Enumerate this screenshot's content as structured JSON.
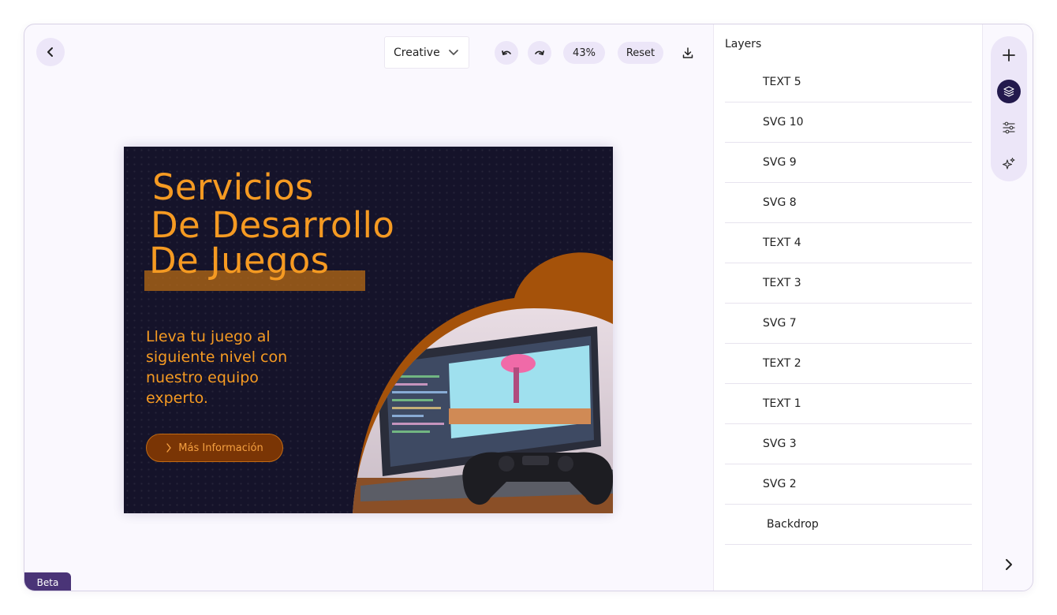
{
  "toolbar": {
    "preset_value": "Creative",
    "zoom": "43%",
    "reset_label": "Reset"
  },
  "design": {
    "headline_lines": [
      "Servicios",
      "De Desarrollo",
      "De Juegos"
    ],
    "subtext": "Lleva tu juego al siguiente nivel con nuestro equipo experto.",
    "cta_label": "Más Información",
    "colors": {
      "background": "#15132a",
      "accent": "#f59a22",
      "shape": "#a5520a"
    }
  },
  "layers": {
    "title": "Layers",
    "items": [
      "TEXT 5",
      "SVG 10",
      "SVG 9",
      "SVG 8",
      "TEXT 4",
      "TEXT 3",
      "SVG 7",
      "TEXT 2",
      "TEXT 1",
      "SVG 3",
      "SVG 2",
      "Backdrop"
    ]
  },
  "rail": {
    "tools": [
      "plus-icon",
      "layers-icon",
      "sliders-icon",
      "sparkles-icon"
    ],
    "active": "layers-icon"
  },
  "badge": {
    "label": "Beta"
  },
  "colors": {
    "brand": "#4a3477",
    "active_tool": "#231a4d",
    "pill_bg": "#ece6f8"
  }
}
